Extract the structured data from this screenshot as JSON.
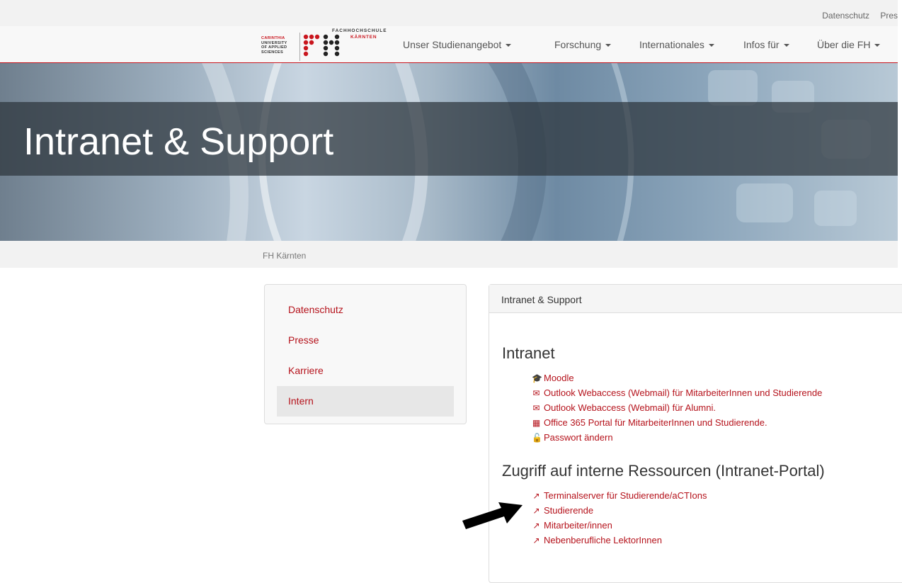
{
  "utility": {
    "links": [
      "Datenschutz",
      "Pres"
    ]
  },
  "logo": {
    "lines": [
      "CARINTHIA",
      "UNIVERSITY",
      "OF APPLIED",
      "SCIENCES"
    ],
    "top": "FACHHOCHSCHULE",
    "name": "KÄRNTEN"
  },
  "nav": {
    "items": [
      "Unser Studienangebot",
      "Forschung",
      "Internationales",
      "Infos für",
      "Über die FH"
    ]
  },
  "hero": {
    "title": "Intranet & Support"
  },
  "breadcrumb": {
    "text": "FH Kärnten"
  },
  "sidebar": {
    "items": [
      {
        "label": "Datenschutz",
        "active": false
      },
      {
        "label": "Presse",
        "active": false
      },
      {
        "label": "Karriere",
        "active": false
      },
      {
        "label": "Intern",
        "active": true
      }
    ]
  },
  "panel": {
    "header": "Intranet & Support",
    "intranet": {
      "heading": "Intranet",
      "links": [
        {
          "icon": "graduation-cap-icon",
          "label": "Moodle"
        },
        {
          "icon": "envelope-icon",
          "label": "Outlook Webaccess (Webmail) für MitarbeiterInnen und Studierende"
        },
        {
          "icon": "envelope-icon",
          "label": "Outlook Webaccess (Webmail) für Alumni."
        },
        {
          "icon": "windows-icon",
          "label": "Office 365 Portal für MitarbeiterInnen und Studierende."
        },
        {
          "icon": "unlock-icon",
          "label": "Passwort ändern"
        }
      ]
    },
    "resources": {
      "heading": "Zugriff auf interne Ressourcen (Intranet-Portal)",
      "links": [
        {
          "icon": "external-link-icon",
          "label": "Terminalserver für Studierende/aCTIons"
        },
        {
          "icon": "external-link-icon",
          "label": "Studierende"
        },
        {
          "icon": "external-link-icon",
          "label": "Mitarbeiter/innen"
        },
        {
          "icon": "external-link-icon",
          "label": "Nebenberufliche LektorInnen"
        }
      ]
    }
  },
  "colors": {
    "accent": "#b5121b",
    "brand_red": "#c9161e",
    "annotation_arrow": "#000000"
  }
}
